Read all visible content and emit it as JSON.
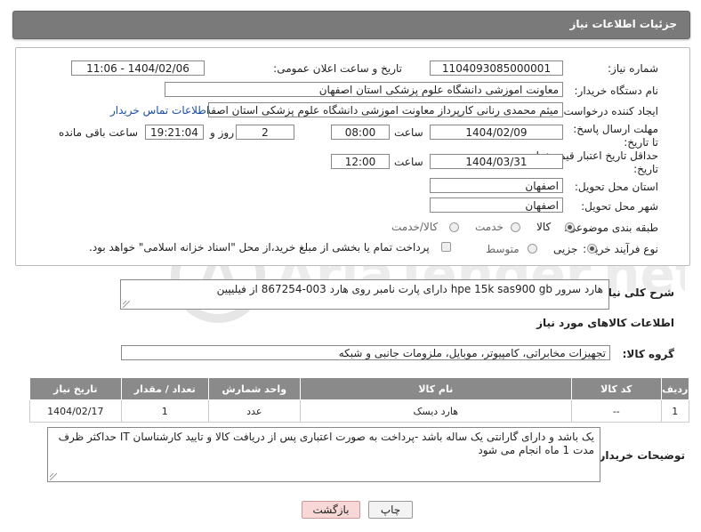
{
  "header": {
    "title": "جزئیات اطلاعات نیاز"
  },
  "fields": {
    "need_number_label": "شماره نیاز:",
    "need_number": "1104093085000001",
    "announce_label": "تاریخ و ساعت اعلان عمومی:",
    "announce_value": "1404/02/06 - 11:06",
    "buyer_org_label": "نام دستگاه خریدار:",
    "buyer_org": "معاونت اموزشی دانشگاه علوم پزشکی استان اصفهان",
    "creator_label": "ایجاد کننده درخواست:",
    "creator": "میثم محمدی رنانی کارپرداز معاونت اموزشی دانشگاه علوم پزشکی استان اصفه",
    "contact_link": "اطلاعات تماس خریدار",
    "deadline_label": "مهلت ارسال پاسخ: تا تاریخ:",
    "deadline_date": "1404/02/09",
    "time_label": "ساعت",
    "deadline_time": "08:00",
    "days_value": "2",
    "days_label": "روز و",
    "remaining_time": "19:21:04",
    "remaining_label": "ساعت باقی مانده",
    "validity_label": "حداقل تاریخ اعتبار قیمت: تا تاریخ:",
    "validity_date": "1404/03/31",
    "validity_time": "12:00",
    "province_label": "استان محل تحویل:",
    "province": "اصفهان",
    "city_label": "شهر محل تحویل:",
    "city": "اصفهان",
    "category_label": "طبقه بندی موضوعی:",
    "category_options": [
      "کالا",
      "خدمت",
      "کالا/خدمت"
    ],
    "process_label": "نوع فرآیند خرید :",
    "process_options": [
      "جزیی",
      "متوسط"
    ],
    "payment_note": "پرداخت تمام یا بخشی از مبلغ خرید،از محل \"اسناد خزانه اسلامی\" خواهد بود."
  },
  "description": {
    "label": "شرح کلی نیاز:",
    "text": "هارد سرور hpe 15k sas900 gb دارای پارت نامبر روی هارد 003-867254 از فیلیپین"
  },
  "goods": {
    "section_title": "اطلاعات کالاهای مورد نیاز",
    "group_label": "گروه کالا:",
    "group_value": "تجهیزات مخابراتی، کامپیوتر، موبایل، ملزومات جانبی و شبکه",
    "columns": [
      "ردیف",
      "کد کالا",
      "نام کالا",
      "واحد شمارش",
      "تعداد / مقدار",
      "تاریخ نیاز"
    ],
    "rows": [
      [
        "1",
        "--",
        "هارد دیسک",
        "عدد",
        "1",
        "1404/02/17"
      ]
    ]
  },
  "buyer_notes": {
    "label": "توضیحات خریدار:",
    "text": "یک باشد و دارای گارانتی یک ساله باشد -پرداخت به صورت اعتباری پس از دریافت کالا و تایید کارشناسان IT حداکثر ظرف مدت 1 ماه انجام می شود"
  },
  "buttons": {
    "print": "چاپ",
    "back": "بازگشت"
  },
  "watermark": "AriaTender.net",
  "colors": {
    "header_bg": "#7a7a7a",
    "table_header_bg": "#8a8a8a",
    "link": "#1a4fa0",
    "back_btn_bg": "#f8d7d7"
  }
}
